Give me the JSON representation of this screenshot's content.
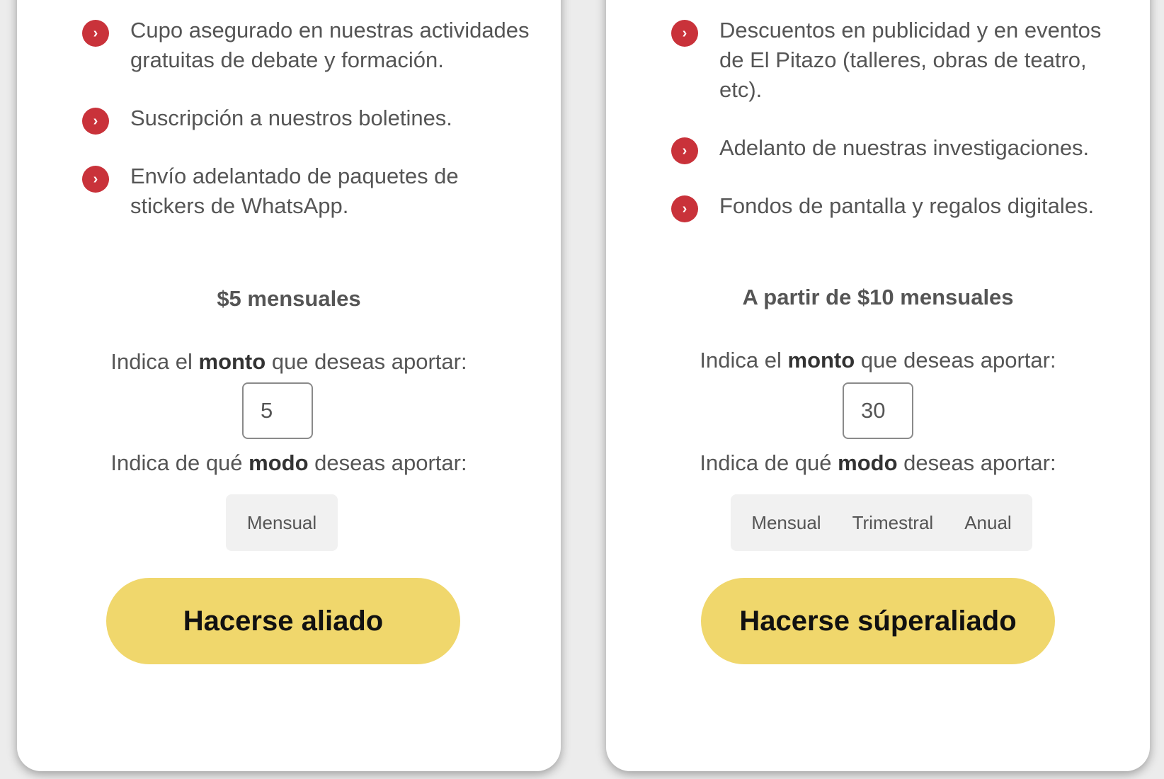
{
  "colors": {
    "bullet": "#c9323a",
    "cta": "#f0d76c",
    "mode_bg": "#f1f1f1"
  },
  "bullet_icon": "chevron-right-icon",
  "bullet_glyph": "›",
  "plans": [
    {
      "benefits": [
        "Cupo asegurado en nuestras actividades gratuitas de debate y formación.",
        "Suscripción a nuestros boletines.",
        "Envío adelantado de paquetes de stickers de WhatsApp."
      ],
      "price": "$5 mensuales",
      "amount_prompt": {
        "before": "Indica el",
        "bold": "monto",
        "after": "que deseas aportar:"
      },
      "amount_value": "5",
      "mode_prompt": {
        "before": "Indica de qué",
        "bold": "modo",
        "after": "deseas aportar:"
      },
      "modes": [
        "Mensual"
      ],
      "cta": "Hacerse aliado"
    },
    {
      "benefits": [
        "Descuentos en publicidad y en eventos de El Pitazo (talleres, obras de teatro, etc).",
        "Adelanto de nuestras investigaciones.",
        "Fondos de pantalla y regalos digitales."
      ],
      "price": "A partir de $10 mensuales",
      "amount_prompt": {
        "before": "Indica el",
        "bold": "monto",
        "after": "que deseas aportar:"
      },
      "amount_value": "30",
      "mode_prompt": {
        "before": "Indica de qué",
        "bold": "modo",
        "after": "deseas aportar:"
      },
      "modes": [
        "Mensual",
        "Trimestral",
        "Anual"
      ],
      "cta": "Hacerse súperaliado"
    }
  ]
}
